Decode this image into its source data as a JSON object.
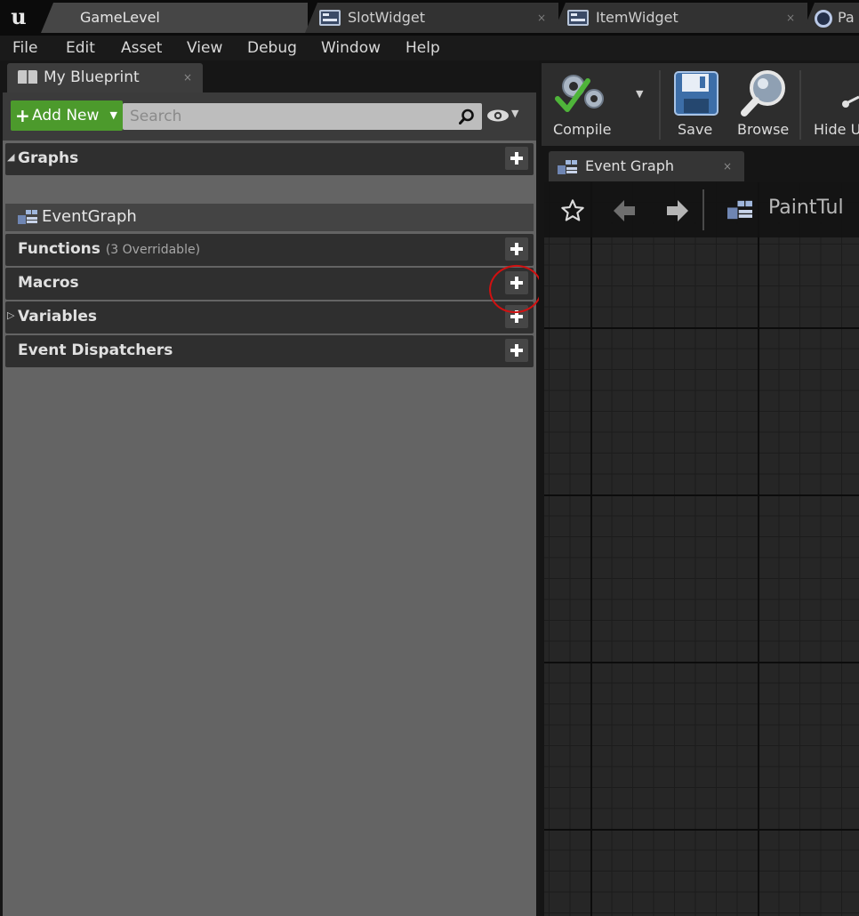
{
  "tabs": [
    {
      "label": "GameLevel",
      "close": ""
    },
    {
      "label": "SlotWidget",
      "close": "×"
    },
    {
      "label": "ItemWidget",
      "close": "×"
    },
    {
      "label": "Pa",
      "close": ""
    }
  ],
  "menu": [
    "File",
    "Edit",
    "Asset",
    "View",
    "Debug",
    "Window",
    "Help"
  ],
  "my_blueprint": {
    "tab_label": "My Blueprint",
    "close": "×",
    "add_new_label": "Add New",
    "search_placeholder": "Search",
    "sections": {
      "graphs": {
        "label": "Graphs",
        "items": [
          "EventGraph"
        ]
      },
      "functions": {
        "label": "Functions",
        "sub": "(3 Overridable)"
      },
      "macros": {
        "label": "Macros"
      },
      "variables": {
        "label": "Variables"
      },
      "event_dispatchers": {
        "label": "Event Dispatchers"
      }
    }
  },
  "toolbar": {
    "compile": "Compile",
    "save": "Save",
    "browse": "Browse",
    "hide": "Hide U"
  },
  "graph_tab": {
    "label": "Event Graph",
    "close": "×"
  },
  "graph_nav": {
    "path": "PaintTul"
  },
  "annotation": {
    "highlight_color": "#d11010"
  },
  "colors": {
    "add_new": "#4c9a2c",
    "accent": "#d11010"
  }
}
